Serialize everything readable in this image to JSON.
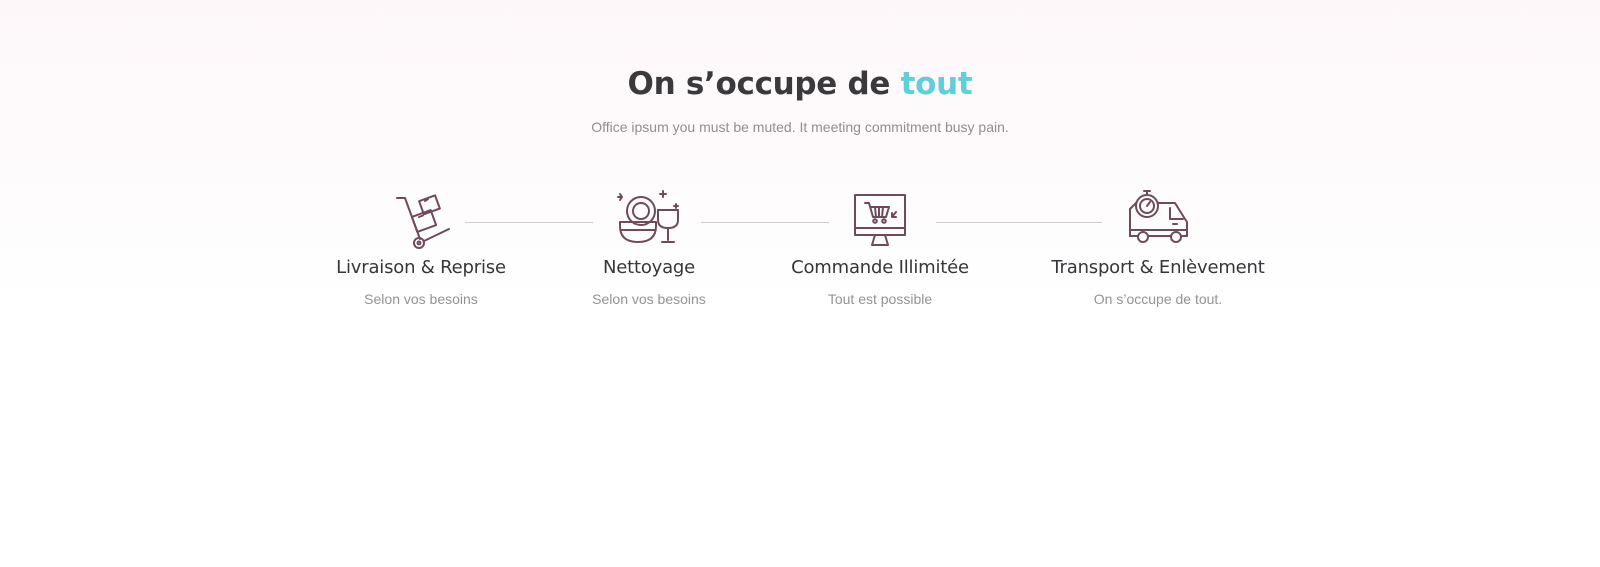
{
  "section": {
    "title_main": "On s’occupe de ",
    "title_accent": "tout",
    "subtitle": "Office ipsum you must be muted. It meeting commitment busy pain."
  },
  "features": [
    {
      "icon": "hand-truck-icon",
      "title": "Livraison & Reprise",
      "desc": "Selon vos besoins"
    },
    {
      "icon": "dishes-glass-icon",
      "title": "Nettoyage",
      "desc": "Selon vos besoins"
    },
    {
      "icon": "monitor-cart-icon",
      "title": "Commande Illimitée",
      "desc": "Tout est possible"
    },
    {
      "icon": "delivery-van-icon",
      "title": "Transport & Enlèvement",
      "desc": "On s’occupe de tout."
    }
  ],
  "colors": {
    "accent": "#5fcfd9",
    "icon": "#6f4a5d",
    "heading": "#3a3a3c",
    "muted": "#8f8e93",
    "connector": "#cfccd0"
  }
}
